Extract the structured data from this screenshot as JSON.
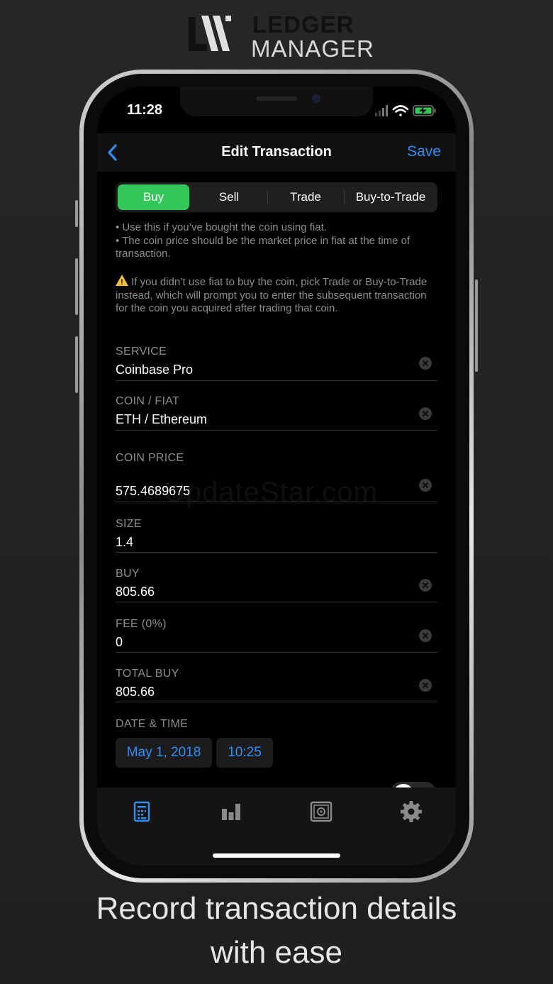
{
  "brand": {
    "line1": "LEDGER",
    "line2": "MANAGER"
  },
  "status_bar": {
    "time": "11:28"
  },
  "nav": {
    "title": "Edit Transaction",
    "save_label": "Save"
  },
  "segments": [
    {
      "label": "Buy",
      "active": true
    },
    {
      "label": "Sell",
      "active": false
    },
    {
      "label": "Trade",
      "active": false
    },
    {
      "label": "Buy-to-Trade",
      "active": false
    }
  ],
  "notes": {
    "tip1": "• Use this if you’ve bought the coin using fiat.",
    "tip2": "• The coin price should be the market price in fiat at the time of transaction.",
    "warning": "If you didn’t use fiat to buy the coin, pick Trade or Buy-to-Trade instead, which will prompt you to enter the subsequent transaction for the coin you acquired after trading that coin."
  },
  "fields": {
    "service": {
      "label": "SERVICE",
      "value": "Coinbase Pro"
    },
    "coin_fiat": {
      "label": "COIN / FIAT",
      "value": "ETH / Ethereum"
    },
    "coin_price": {
      "label": "COIN PRICE",
      "value": "575.4689675"
    },
    "size": {
      "label": "SIZE",
      "value": "1.4"
    },
    "buy": {
      "label": "BUY",
      "value": "805.66"
    },
    "fee": {
      "label": "FEE (0%)",
      "value": "0"
    },
    "total_buy": {
      "label": "TOTAL BUY",
      "value": "805.66"
    }
  },
  "datetime": {
    "label": "DATE & TIME",
    "date": "May 1, 2018",
    "time": "10:25"
  },
  "tabs": [
    {
      "icon": "transactions-icon",
      "active": true
    },
    {
      "icon": "bar-chart-icon",
      "active": false
    },
    {
      "icon": "vault-icon",
      "active": false
    },
    {
      "icon": "gear-icon",
      "active": false
    }
  ],
  "watermark": "UpdateStar.com",
  "caption": {
    "line1": "Record transaction details",
    "line2": "with ease"
  },
  "colors": {
    "accent": "#2f8ef4",
    "active_segment": "#33c759",
    "warning": "#f2c230"
  }
}
